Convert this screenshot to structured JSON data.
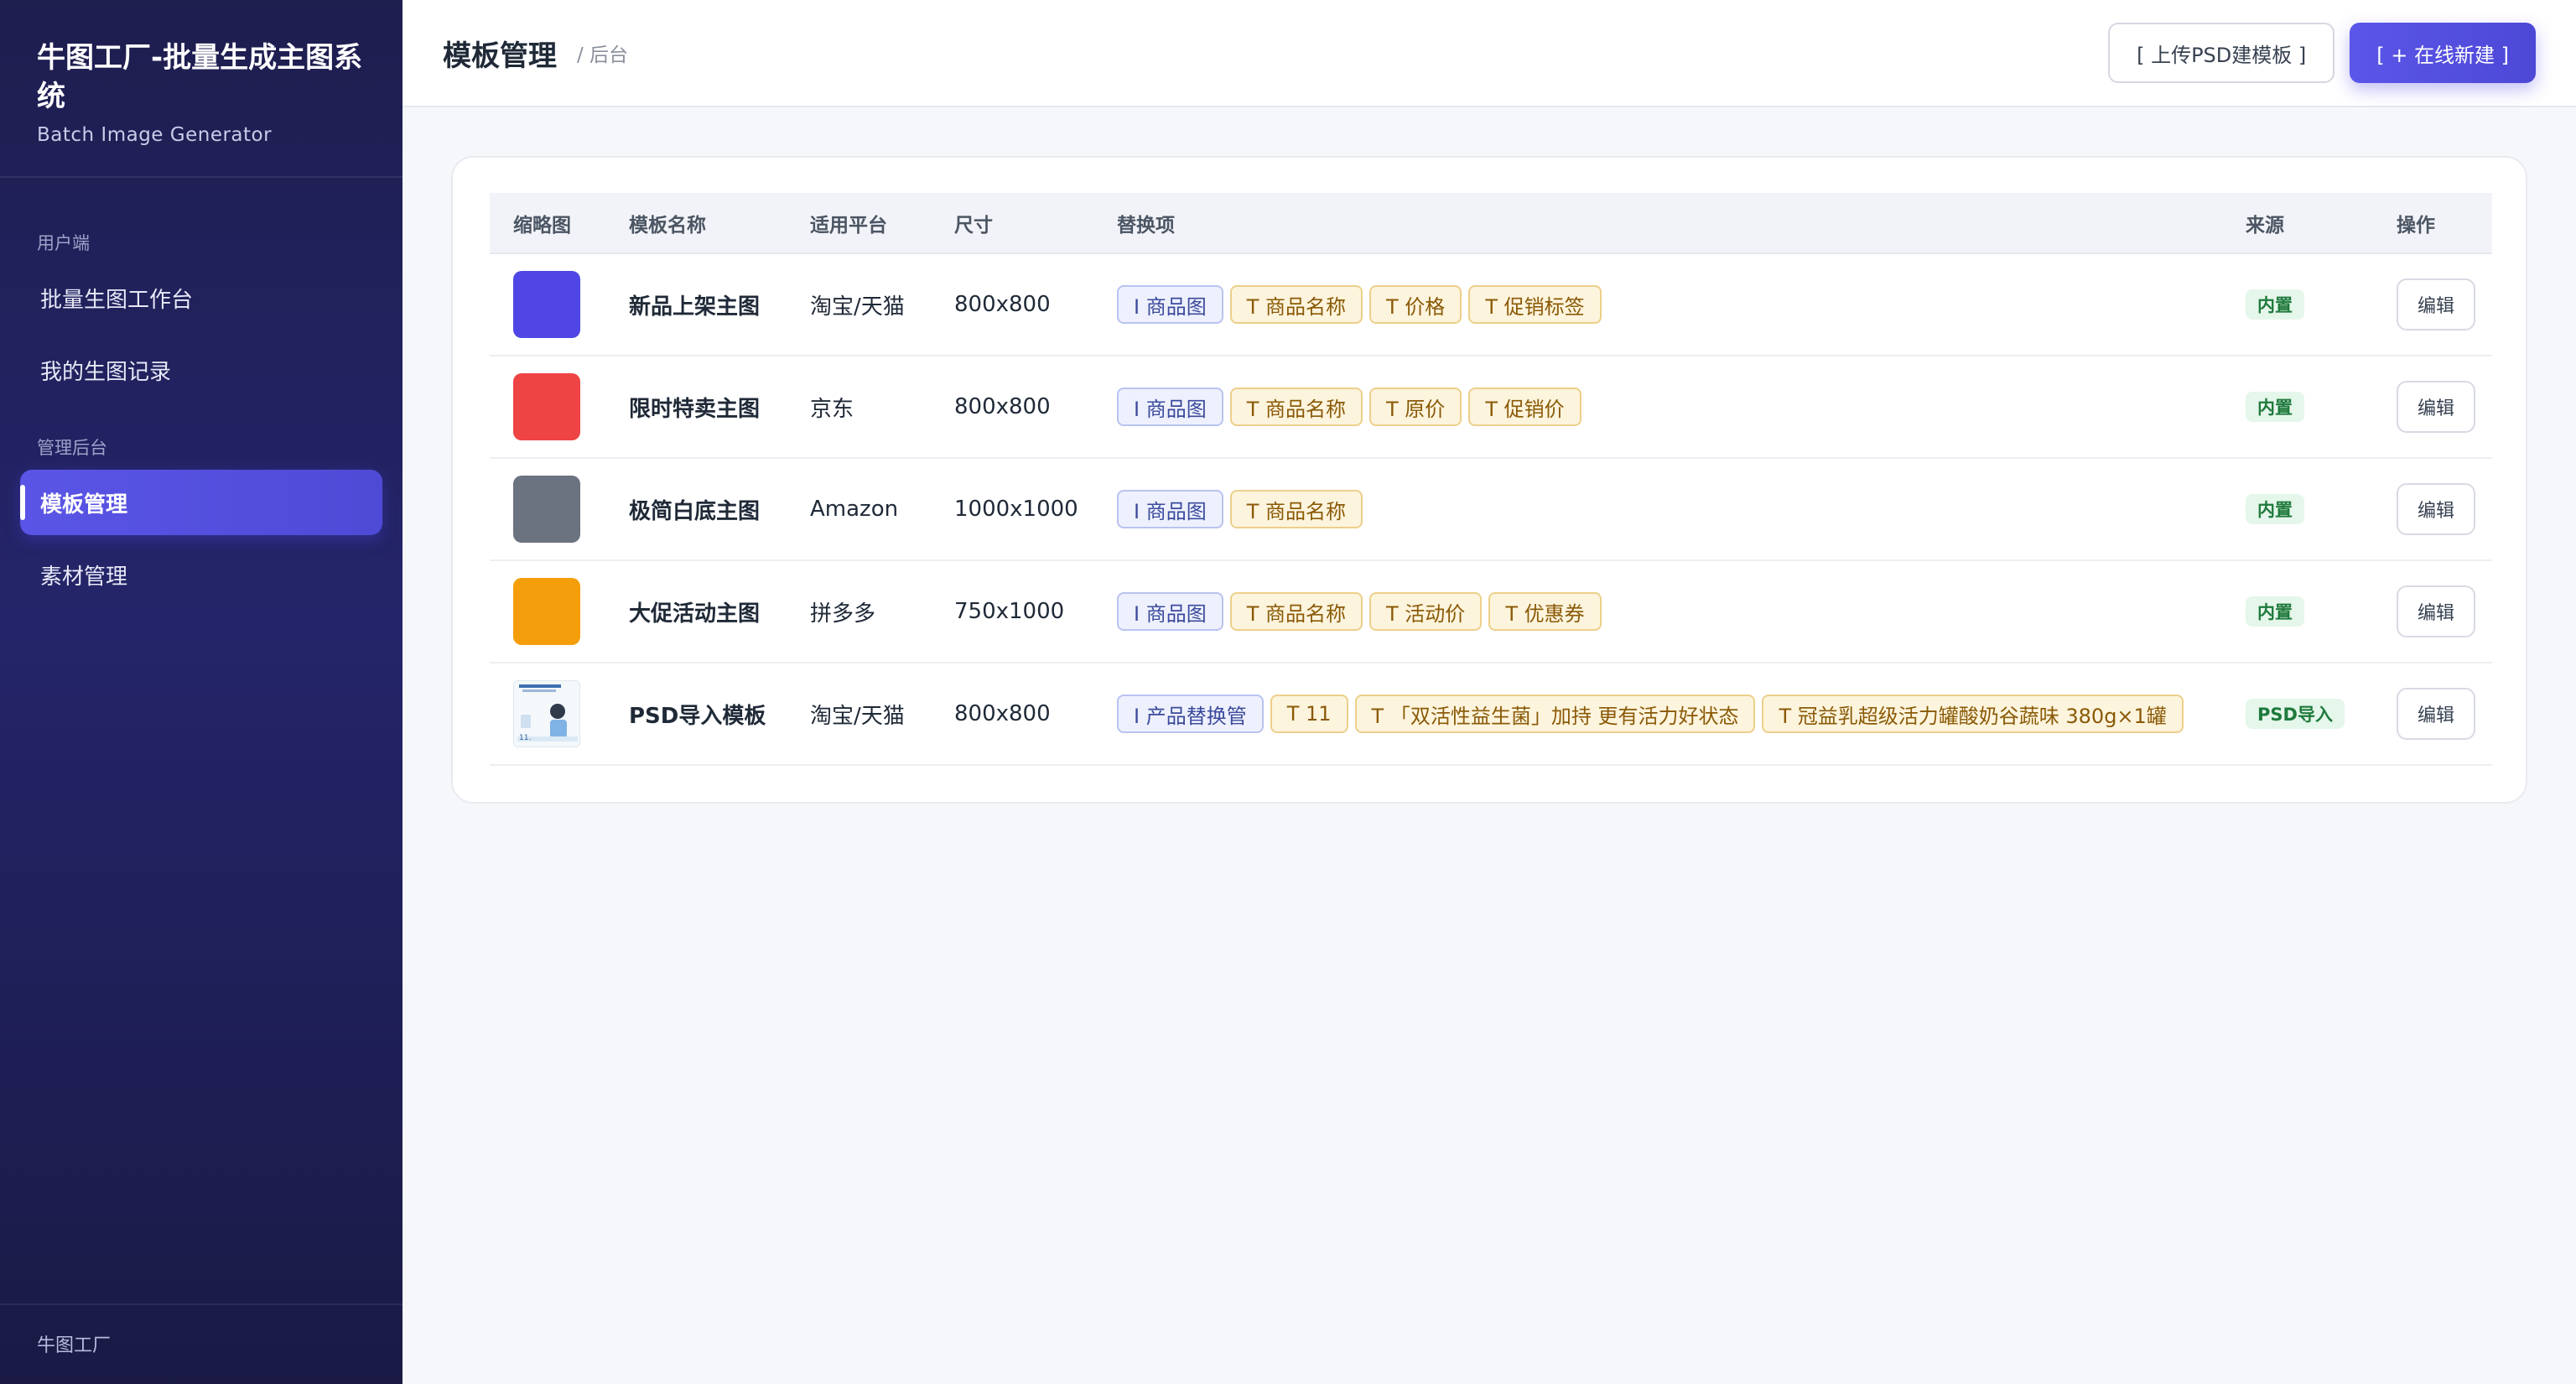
{
  "sidebar": {
    "brand_title": "牛图工厂-批量生成主图系统",
    "brand_subtitle": "Batch Image Generator",
    "section_user": "用户端",
    "section_admin": "管理后台",
    "items": [
      {
        "label": "批量生图工作台"
      },
      {
        "label": "我的生图记录"
      },
      {
        "label": "模板管理"
      },
      {
        "label": "素材管理"
      }
    ],
    "active_item": "模板管理",
    "footer": "牛图工厂"
  },
  "header": {
    "title": "模板管理",
    "breadcrumb": "/ 后台",
    "upload_button": "[ 上传PSD建模板 ]",
    "new_button": "[ + 在线新建 ]"
  },
  "table": {
    "columns": [
      "缩略图",
      "模板名称",
      "适用平台",
      "尺寸",
      "替换项",
      "来源",
      "操作"
    ],
    "edit_label": "编辑",
    "rows": [
      {
        "thumb_color": "#4f46e5",
        "name": "新品上架主图",
        "platform": "淘宝/天猫",
        "size": "800x800",
        "tags": [
          {
            "type": "img",
            "label": "I 商品图"
          },
          {
            "type": "txt",
            "label": "T 商品名称"
          },
          {
            "type": "txt",
            "label": "T 价格"
          },
          {
            "type": "txt",
            "label": "T 促销标签"
          }
        ],
        "source": "内置"
      },
      {
        "thumb_color": "#ef4444",
        "name": "限时特卖主图",
        "platform": "京东",
        "size": "800x800",
        "tags": [
          {
            "type": "img",
            "label": "I 商品图"
          },
          {
            "type": "txt",
            "label": "T 商品名称"
          },
          {
            "type": "txt",
            "label": "T 原价"
          },
          {
            "type": "txt",
            "label": "T 促销价"
          }
        ],
        "source": "内置"
      },
      {
        "thumb_color": "#6b7280",
        "name": "极简白底主图",
        "platform": "Amazon",
        "size": "1000x1000",
        "tags": [
          {
            "type": "img",
            "label": "I 商品图"
          },
          {
            "type": "txt",
            "label": "T 商品名称"
          }
        ],
        "source": "内置"
      },
      {
        "thumb_color": "#f59e0b",
        "name": "大促活动主图",
        "platform": "拼多多",
        "size": "750x1000",
        "tags": [
          {
            "type": "img",
            "label": "I 商品图"
          },
          {
            "type": "txt",
            "label": "T 商品名称"
          },
          {
            "type": "txt",
            "label": "T 活动价"
          },
          {
            "type": "txt",
            "label": "T 优惠券"
          }
        ],
        "source": "内置"
      },
      {
        "thumb_color": "",
        "name": "PSD导入模板",
        "platform": "淘宝/天猫",
        "size": "800x800",
        "tags": [
          {
            "type": "img",
            "label": "I 产品替换管"
          },
          {
            "type": "txt",
            "label": "T 11"
          },
          {
            "type": "txt",
            "label": "T 「双活性益生菌」加持 更有活力好状态"
          },
          {
            "type": "txt",
            "label": "T 冠益乳超级活力罐酸奶谷蔬味 380g×1罐"
          }
        ],
        "source": "PSD导入"
      }
    ]
  }
}
